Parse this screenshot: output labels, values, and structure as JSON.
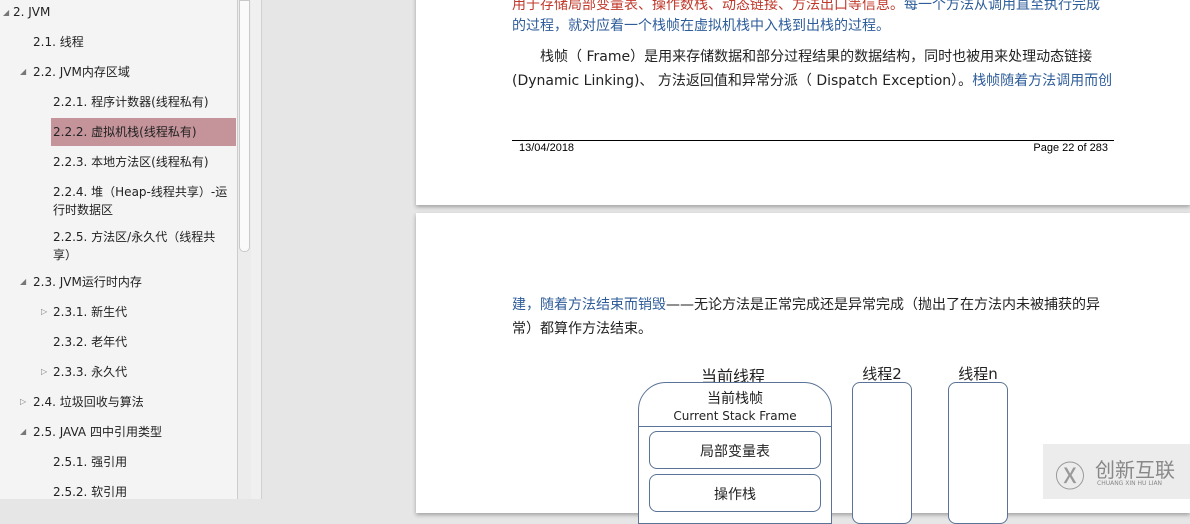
{
  "sidebar": {
    "items": [
      {
        "label": "2. JVM",
        "expanded": true
      },
      {
        "label": "2.1. 线程"
      },
      {
        "label": "2.2. JVM内存区域",
        "expanded": true
      },
      {
        "label": "2.2.1. 程序计数器(线程私有)"
      },
      {
        "label": "2.2.2. 虚拟机栈(线程私有)",
        "selected": true
      },
      {
        "label": "2.2.3. 本地方法区(线程私有)"
      },
      {
        "label": "2.2.4. 堆（Heap-线程共享）-运行时数据区"
      },
      {
        "label": "2.2.5. 方法区/永久代（线程共享）"
      },
      {
        "label": "2.3. JVM运行时内存",
        "expanded": true
      },
      {
        "label": "2.3.1. 新生代",
        "expanded": false
      },
      {
        "label": "2.3.2. 老年代"
      },
      {
        "label": "2.3.3. 永久代",
        "expanded": false
      },
      {
        "label": "2.4. 垃圾回收与算法",
        "expanded": false
      },
      {
        "label": "2.5. JAVA 四中引用类型",
        "expanded": true
      },
      {
        "label": "2.5.1. 强引用"
      },
      {
        "label": "2.5.2. 软引用"
      }
    ]
  },
  "page1": {
    "line0_red": "用于存储局部变量表、操作数栈、动态链接、方法出口等信息。",
    "line0_blue": "每一个方法从调用直至执行完成",
    "line1": "的过程，就对应着一个栈帧在虚拟机栈中入栈到出栈的过程。",
    "line2": "栈帧（ Frame）是用来存储数据和部分过程结果的数据结构，同时也被用来处理动态链接",
    "line3a": "(Dynamic Linking)、 方法返回值和异常分派（ Dispatch Exception）。",
    "line3b": "栈帧随着方法调用而创",
    "footer_date": "13/04/2018",
    "footer_page": "Page 22 of 283"
  },
  "page2": {
    "line1a": "建，随着方法结束而销毁",
    "line1b": "——无论方法是正常完成还是异常完成（抛出了在方法内未被捕获的异",
    "line2": "常）都算作方法结束。",
    "diagram": {
      "current_thread": "当前线程",
      "thread2": "线程2",
      "threadn": "线程n",
      "current_frame": "当前栈帧",
      "current_frame_en": "Current Stack Frame",
      "local_vars": "局部变量表",
      "operand_stack": "操作栈"
    }
  },
  "watermark": {
    "text": "创新互联",
    "sub": "CHUANG XIN HU LIAN"
  }
}
